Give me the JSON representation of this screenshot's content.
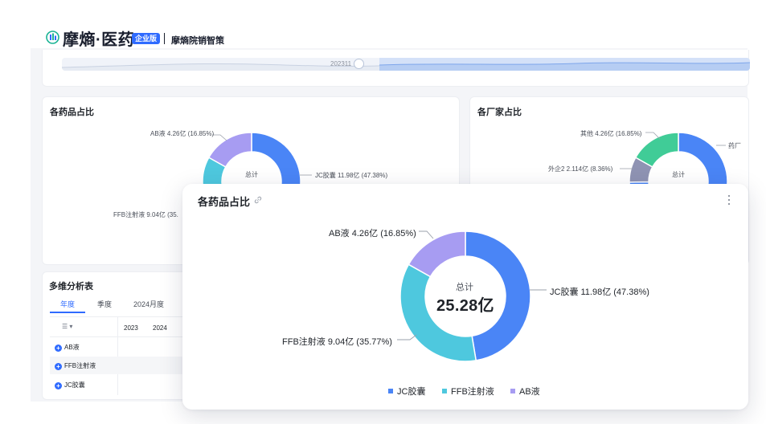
{
  "header": {
    "brand": "摩熵·医药",
    "edition": "企业版",
    "product": "摩熵院销智策"
  },
  "timeline": {
    "label": "202311"
  },
  "drug_card": {
    "title": "各药品占比",
    "center_label": "总计",
    "labels": {
      "ab": "AB液 4.26亿 (16.85%)",
      "jc": "JC胶囊 11.98亿 (47.38%)",
      "ffb": "FFB注射液 9.04亿 (35."
    }
  },
  "maker_card": {
    "title": "各厂家占比",
    "center_label": "总计",
    "labels": {
      "other": "其他 4.26亿 (16.85%)",
      "foreign2": "外企2 2.114亿 (8.36%)",
      "cut": "药厂"
    }
  },
  "multi_table": {
    "title": "多维分析表",
    "tabs": [
      "年度",
      "季度",
      "2024月度"
    ],
    "columns": [
      "2023",
      "2024"
    ],
    "rows": [
      "AB液",
      "FFB注射液",
      "JC胶囊"
    ]
  },
  "popup": {
    "title": "各药品占比",
    "center_label": "总计",
    "center_total": "25.28亿",
    "legend": [
      "JC胶囊",
      "FFB注射液",
      "AB液"
    ]
  },
  "colors": {
    "jc": "#4a85f6",
    "ffb": "#4ec8de",
    "ab": "#a79cf2",
    "other": "#40cc97",
    "foreign2": "#8f93b3"
  },
  "chart_data": [
    {
      "type": "pie",
      "title": "各药品占比",
      "categories": [
        "JC胶囊",
        "FFB注射液",
        "AB液"
      ],
      "values": [
        11.98,
        9.04,
        4.26
      ],
      "percents": [
        47.38,
        35.77,
        16.85
      ],
      "unit": "亿",
      "total": 25.28,
      "legend": "bottom"
    },
    {
      "type": "pie",
      "title": "各厂家占比",
      "categories": [
        "其他",
        "外企2"
      ],
      "values": [
        4.26,
        2.114
      ],
      "percents": [
        16.85,
        8.36
      ],
      "unit": "亿"
    }
  ],
  "popup_labels": {
    "jc": "JC胶囊 11.98亿 (47.38%)",
    "ffb": "FFB注射液 9.04亿 (35.77%)",
    "ab": "AB液 4.26亿 (16.85%)"
  }
}
